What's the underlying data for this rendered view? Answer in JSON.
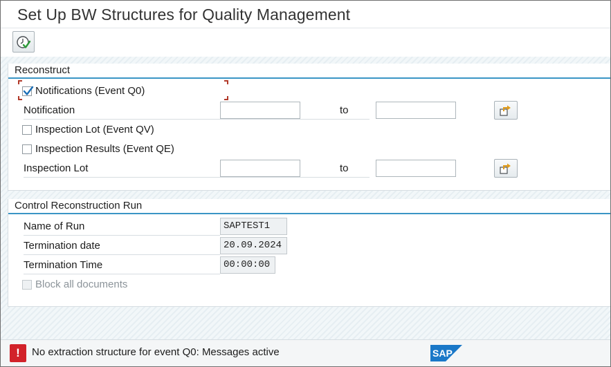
{
  "window": {
    "title": "Set Up BW Structures for Quality Management"
  },
  "toolbar": {
    "execute_icon": "execute-icon"
  },
  "reconstruct": {
    "title": "Reconstruct",
    "notifications_checkbox": {
      "label": "Notifications (Event Q0)",
      "checked": true
    },
    "notification_range": {
      "label": "Notification",
      "from": "",
      "to_label": "to",
      "to": ""
    },
    "inspection_lot_checkbox": {
      "label": "Inspection Lot (Event QV)",
      "checked": false
    },
    "inspection_results_checkbox": {
      "label": "Inspection Results (Event QE)",
      "checked": false
    },
    "inspection_lot_range": {
      "label": "Inspection Lot",
      "from": "",
      "to_label": "to",
      "to": ""
    }
  },
  "control": {
    "title": "Control Reconstruction Run",
    "name_of_run": {
      "label": "Name of Run",
      "value": "SAPTEST1"
    },
    "termination_date": {
      "label": "Termination date",
      "value": "20.09.2024"
    },
    "termination_time": {
      "label": "Termination Time",
      "value": "00:00:00"
    },
    "block_all": {
      "label": "Block all documents",
      "checked": false,
      "disabled": true
    }
  },
  "status": {
    "icon": "error-icon",
    "icon_glyph": "!",
    "message": "No extraction structure for event Q0: Messages active",
    "logo": "SAP"
  },
  "colors": {
    "accent": "#3a95c5",
    "error": "#d2222a",
    "sap_blue": "#1a78c8"
  }
}
